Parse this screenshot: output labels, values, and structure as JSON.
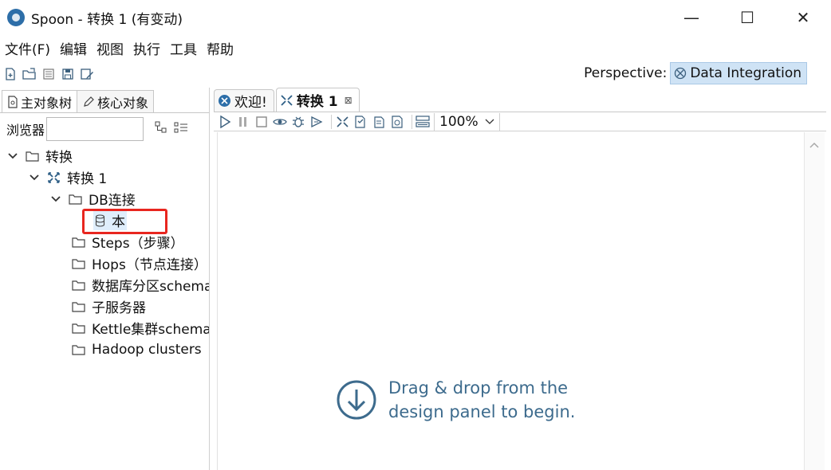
{
  "window": {
    "title": "Spoon - 转换 1 (有变动)",
    "controls": {
      "minimize": "—",
      "maximize": "☐",
      "close": "✕"
    }
  },
  "menu": [
    "文件(F)",
    "编辑",
    "视图",
    "执行",
    "工具",
    "帮助"
  ],
  "perspective": {
    "label": "Perspective:",
    "value": "Data Integration"
  },
  "left_panel": {
    "tabs": [
      "主对象树",
      "核心对象"
    ],
    "browser_label": "浏览器",
    "browser_value": "",
    "tree": [
      {
        "label": "转换",
        "level": 0,
        "expanded": true,
        "icon": "folder-icon"
      },
      {
        "label": "转换 1",
        "level": 1,
        "expanded": true,
        "icon": "transformation-icon"
      },
      {
        "label": "DB连接",
        "level": 2,
        "expanded": true,
        "icon": "folder-icon"
      },
      {
        "label": "本",
        "level": 3,
        "icon": "database-icon",
        "selected": true
      },
      {
        "label": "Steps（步骤）",
        "level": 2,
        "icon": "folder-icon"
      },
      {
        "label": "Hops（节点连接）",
        "level": 2,
        "icon": "folder-icon"
      },
      {
        "label": "数据库分区schema",
        "level": 2,
        "icon": "folder-icon"
      },
      {
        "label": "子服务器",
        "level": 2,
        "icon": "folder-icon"
      },
      {
        "label": "Kettle集群schema",
        "level": 2,
        "icon": "folder-icon"
      },
      {
        "label": "Hadoop clusters",
        "level": 2,
        "icon": "folder-icon"
      }
    ]
  },
  "editor": {
    "tabs": [
      {
        "label": "欢迎!",
        "active": false
      },
      {
        "label": "转换 1",
        "active": true,
        "close": "⊠"
      }
    ],
    "zoom": "100%",
    "hint_line1": "Drag & drop from the",
    "hint_line2": "design panel to begin."
  },
  "colors": {
    "highlight_box": "#e8261f",
    "hint_text": "#3d6b8d",
    "perspective_bg": "#cfe3f5"
  }
}
